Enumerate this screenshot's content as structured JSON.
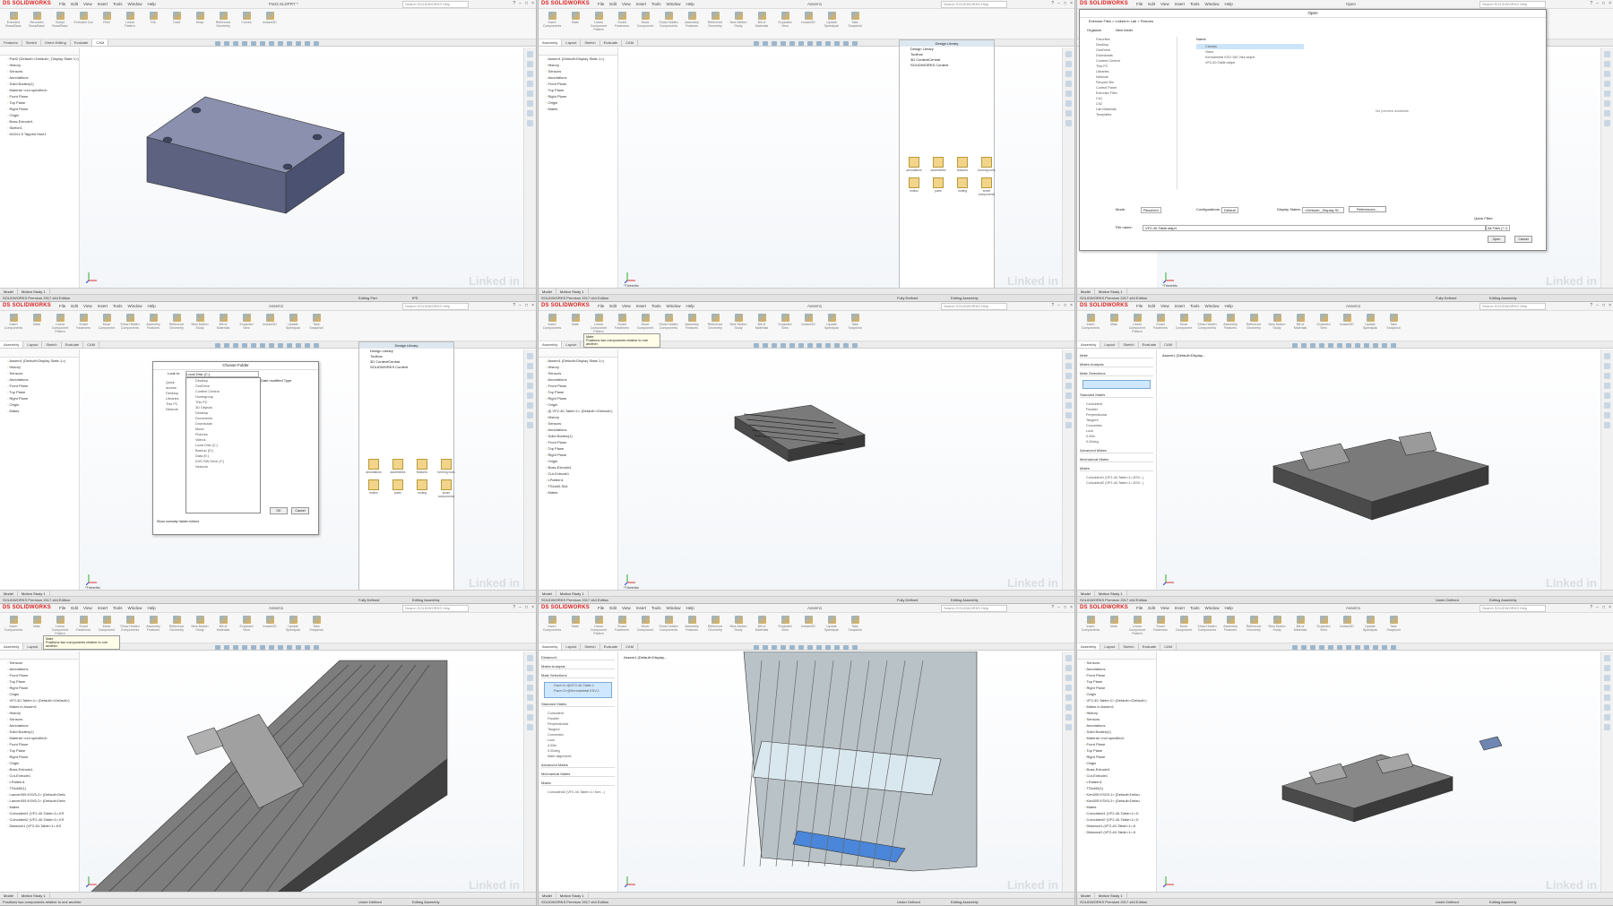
{
  "app": {
    "logo": "DS SOLIDWORKS",
    "menu": [
      "File",
      "Edit",
      "View",
      "Insert",
      "Tools",
      "Window",
      "Help"
    ],
    "search_placeholder": "Search SOLIDWORKS Help",
    "win_controls": [
      "?",
      "−",
      "□",
      "×"
    ],
    "watermark": "Linked in"
  },
  "ribbon": {
    "part_items": [
      "Extruded Boss/Base",
      "Revolved Boss/Base",
      "Swept Boss/Base",
      "Extruded Cut",
      "Fillet",
      "Linear Pattern",
      "Rib",
      "Draft",
      "Wrap",
      "Reference Geometry",
      "Curves",
      "Instant3D"
    ],
    "asm_items": [
      "Insert Components",
      "Mate",
      "Linear Component Pattern",
      "Smart Fasteners",
      "Move Component",
      "Show Hidden Components",
      "Assembly Features",
      "Reference Geometry",
      "New Motion Study",
      "Bill of Materials",
      "Exploded View",
      "Instant3D",
      "Update Speedpak",
      "Take Snapshot"
    ]
  },
  "tabs": {
    "part": [
      "Features",
      "Sketch",
      "Direct Editing",
      "Evaluate",
      "CAM"
    ],
    "asm": [
      "Assembly",
      "Layout",
      "Sketch",
      "Evaluate",
      "CAM"
    ]
  },
  "bottom_tabs": [
    "Model",
    "Motion Study 1"
  ],
  "panels": [
    {
      "id": "p1",
      "doc": "Part2.SLDPRT *",
      "mode": "part",
      "tree": [
        "Part2 (Default<<Default>_Display State 1>)",
        "History",
        "Sensors",
        "Annotations",
        "Solid Bodies(1)",
        "Material <not specified>",
        "Front Plane",
        "Top Plane",
        "Right Plane",
        "Origin",
        "Boss-Extrude1",
        "Sketch1",
        "M10x1.5 Tapped Hole1"
      ],
      "status_left": "SOLIDWORKS Premium 2017 x64 Edition",
      "status_mid": "Editing Part",
      "status_right": "IPS"
    },
    {
      "id": "p2",
      "doc": "Assem1",
      "mode": "asm",
      "tree": [
        "Assem1 (Default<Display State-1>)",
        "History",
        "Sensors",
        "Annotations",
        "Front Plane",
        "Top Plane",
        "Right Plane",
        "Origin",
        "Mates"
      ],
      "design_library": {
        "title": "Design Library",
        "nodes": [
          "Design Library",
          "Toolbox",
          "3D ContentCentral",
          "SOLIDWORKS Content"
        ],
        "folders": [
          "annotations",
          "assemblies",
          "features",
          "forming tools",
          "motion",
          "parts",
          "routing",
          "smart components"
        ]
      },
      "view_label": "*Trimetric",
      "status_left": "SOLIDWORKS Premium 2017 x64 Edition",
      "status_mid": "Fully Defined",
      "status_right": "Editing Assembly"
    },
    {
      "id": "p3",
      "doc": "Open",
      "mode": "dialog",
      "open_dialog": {
        "title": "Open",
        "breadcrumb": "Exercise Files > Linked in Lab > Fixtures",
        "organize": "Organize",
        "new_folder": "New folder",
        "nav": [
          "Favorites",
          "Desktop",
          "OneDrive",
          "Downloads",
          "Content Central",
          "This PC",
          "Libraries",
          "Network",
          "Recycle Bin",
          "Control Panel",
          "Exercise Files",
          "Ch1",
          "Ch2",
          "Lab Materials",
          "Templates"
        ],
        "files_header": "Name",
        "files": [
          "Clamps",
          "Vises",
          "Kennametal KSV-150 Vise.sldprt",
          "VF2-40-Table.sldprt"
        ],
        "no_preview": "No preview available.",
        "mode_label": "Mode:",
        "mode_value": "Resolved",
        "config_label": "Configurations:",
        "config_value": "Default",
        "display_label": "Display States:",
        "display_value": "<Default>_Display St...",
        "references": "References...",
        "filename_label": "File name:",
        "filename_value": "VF2-40-Table.sldprt",
        "quick_filter": "Quick Filter:",
        "filetype": "All Files (*.*)",
        "open": "Open",
        "cancel": "Cancel"
      },
      "view_label": "*Trimetric",
      "status_left": "SOLIDWORKS Premium 2017 x64 Edition",
      "status_mid": "Fully Defined",
      "status_right": "Editing Assembly"
    },
    {
      "id": "p4",
      "doc": "Assem1",
      "mode": "asm",
      "tree": [
        "Assem1 (Default<Display State-1>)",
        "History",
        "Sensors",
        "Annotations",
        "Front Plane",
        "Top Plane",
        "Right Plane",
        "Origin",
        "Mates"
      ],
      "choose_folder": {
        "title": "Choose Folder",
        "look_in": "Look in:",
        "look_in_value": "Local Disk (C:)",
        "places": [
          "Quick access",
          "Desktop",
          "Libraries",
          "This PC",
          "Network"
        ],
        "columns": [
          "Date modified",
          "Type"
        ],
        "list": [
          "Desktop",
          "OneDrive",
          "Content Central",
          "Homegroup",
          "This PC",
          "3D Objects",
          "Desktop",
          "Documents",
          "Downloads",
          "Music",
          "Pictures",
          "Videos",
          "Local Disk (C:)",
          "Backup (D:)",
          "Data (E:)",
          "DVD RW Drive (F:)",
          "Network"
        ],
        "show_hidden": "Show normally hidden folders",
        "ok": "OK",
        "cancel": "Cancel"
      },
      "design_library": {
        "title": "Design Library",
        "nodes": [
          "Design Library",
          "Toolbox",
          "3D ContentCentral",
          "SOLIDWORKS Content"
        ],
        "folders": [
          "annotations",
          "assemblies",
          "features",
          "forming tools",
          "motion",
          "parts",
          "routing",
          "smart components"
        ]
      },
      "view_label": "*Trimetric",
      "status_left": "SOLIDWORKS Premium 2017 x64 Edition",
      "status_mid": "Fully Defined",
      "status_right": "Editing Assembly"
    },
    {
      "id": "p5",
      "doc": "Assem1",
      "mode": "asm",
      "tooltip_title": "Mate",
      "tooltip_text": "Positions two components relative to one another.",
      "tree": [
        "Assem1 (Default<Display State-1>)",
        "History",
        "Sensors",
        "Annotations",
        "Front Plane",
        "Top Plane",
        "Right Plane",
        "Origin",
        "(f) VF2-40-Table<1> (Default<<Default>)",
        "History",
        "Sensors",
        "Annotations",
        "Solid Bodies(1)",
        "Front Plane",
        "Top Plane",
        "Right Plane",
        "Origin",
        "Boss-Extrude1",
        "Cut-Extrude1",
        "LPattern1",
        "TSlot40-Slot",
        "Mates"
      ],
      "view_label": "*Trimetric",
      "status_left": "SOLIDWORKS Premium 2017 x64 Edition",
      "status_mid": "Fully Defined",
      "status_right": "Editing Assembly"
    },
    {
      "id": "p6",
      "doc": "Assem1",
      "mode": "asm",
      "pm": {
        "title": "Mate",
        "tabs": [
          "Mates",
          "Analysis"
        ],
        "selections": "Mate Selections",
        "standard": "Standard Mates",
        "std_items": [
          "Coincident",
          "Parallel",
          "Perpendicular",
          "Tangent",
          "Concentric",
          "Lock"
        ],
        "distance": "0.00in",
        "angle": "0.00deg",
        "advanced": "Advanced Mates",
        "mechanical": "Mechanical Mates",
        "mates": "Mates",
        "mate_list": [
          "Coincident1 (VF2-40-Table<1>,KSV...)",
          "Coincident2 (VF2-40-Table<1>,KSV...)"
        ]
      },
      "breadcrumb": "Assem1 (Default<Display...",
      "status_left": "SOLIDWORKS Premium 2017 x64 Edition",
      "status_mid": "Under Defined",
      "status_right": "Editing Assembly"
    },
    {
      "id": "p7",
      "doc": "Assem1",
      "mode": "asm",
      "tooltip_title": "Mate",
      "tooltip_text": "Positions two components relative to one another.",
      "tree": [
        "Sensors",
        "Annotations",
        "Front Plane",
        "Top Plane",
        "Right Plane",
        "Origin",
        "VF2-40-Table<1> (Default<<Default>)",
        "Mates in Assem1",
        "History",
        "Sensors",
        "Annotations",
        "Solid Bodies(1)",
        "Material <not specified>",
        "Front Plane",
        "Top Plane",
        "Right Plane",
        "Origin",
        "Boss-Extrude1",
        "Cut-Extrude1",
        "LPattern1",
        "TSlot40(1)",
        "Lancer005 KSV5-2> (Default<Defa",
        "Lancer005 KSV5-2> (Default<Defa",
        "Mates",
        "Coincident1 (VF2-40-Table<1>,KS",
        "Coincident2 (VF2-40-Table<1>,KS",
        "Distance1 (VF2-40-Table<1>,KS"
      ],
      "status_left": "Positions two components relative to one another.",
      "status_mid": "Under Defined",
      "status_right": "Editing Assembly"
    },
    {
      "id": "p8",
      "doc": "Assem1",
      "mode": "asm",
      "pm": {
        "title": "Distance1",
        "tabs": [
          "Mates",
          "Analysis"
        ],
        "selections": "Mate Selections",
        "sel_items": [
          "Face<1>@VF2-40-Table-1",
          "Face<2>@Kennametal KSV-1"
        ],
        "standard": "Standard Mates",
        "std_items": [
          "Coincident",
          "Parallel",
          "Perpendicular",
          "Tangent",
          "Concentric",
          "Lock"
        ],
        "distance": "4.00in",
        "angle": "0.00deg",
        "alignment": "Mate alignment:",
        "advanced": "Advanced Mates",
        "mechanical": "Mechanical Mates",
        "mates": "Mates",
        "mate_list": [
          "Coincident2 (VF2-40-Table<1>,Ken...)"
        ]
      },
      "breadcrumb": "Assem1 (Default<Display...",
      "status_left": "SOLIDWORKS Premium 2017 x64 Edition",
      "status_mid": "Under Defined",
      "status_right": "Editing Assembly"
    },
    {
      "id": "p9",
      "doc": "Assem1",
      "mode": "asm",
      "tree": [
        "Sensors",
        "Annotations",
        "Front Plane",
        "Top Plane",
        "Right Plane",
        "Origin",
        "VF2-40-Table<1> (Default<<Default>)",
        "Mates in Assem1",
        "History",
        "Sensors",
        "Annotations",
        "Solid Bodies(1)",
        "Material <not specified>",
        "Front Plane",
        "Top Plane",
        "Right Plane",
        "Origin",
        "Boss-Extrude1",
        "Cut-Extrude1",
        "LPattern1",
        "TSlot40(1)",
        "Ken005 KSV5-1> (Default<Defau",
        "Ken005 KSV5-2> (Default<Defau",
        "Mates",
        "Coincident1 (VF2-40-Table<1>,K",
        "Coincident2 (VF2-40-Table<1>,K",
        "Distance1 (VF2-40-Table<1>,K",
        "Distance2 (VF2-40-Table<1>,K"
      ],
      "status_left": "SOLIDWORKS Premium 2017 x64 Edition",
      "status_mid": "Under Defined",
      "status_right": "Editing Assembly"
    }
  ]
}
